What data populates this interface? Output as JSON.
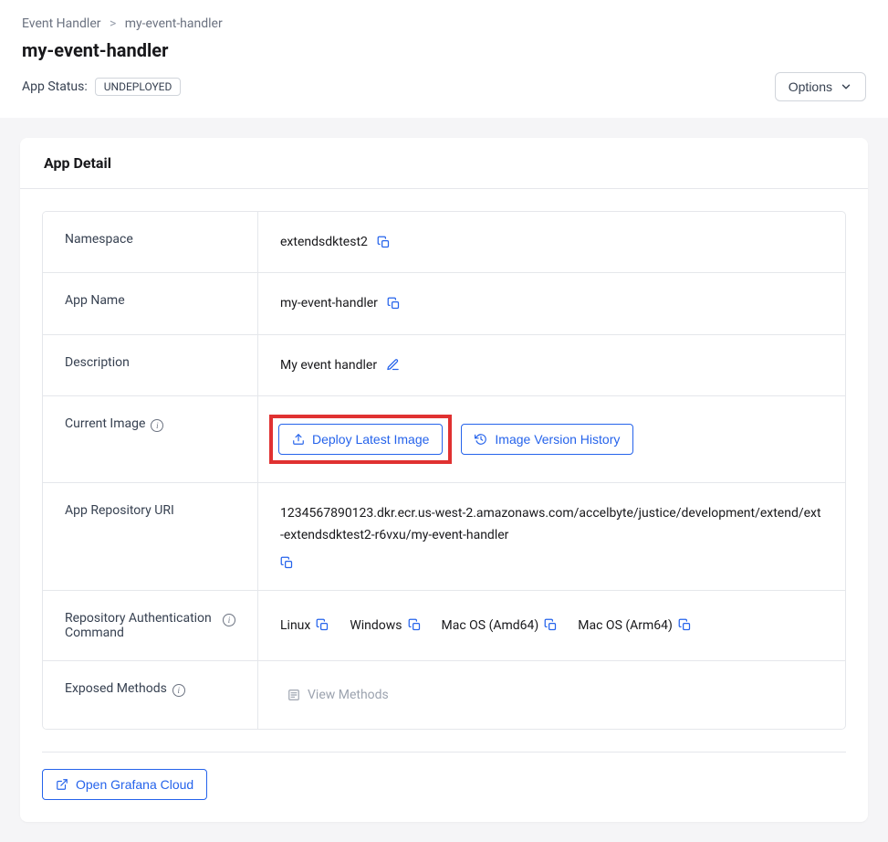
{
  "breadcrumb": {
    "parent": "Event Handler",
    "current": "my-event-handler"
  },
  "page_title": "my-event-handler",
  "app_status": {
    "label": "App Status:",
    "value": "UNDEPLOYED"
  },
  "options_button": "Options",
  "card_title": "App Detail",
  "rows": {
    "namespace": {
      "label": "Namespace",
      "value": "extendsdktest2"
    },
    "app_name": {
      "label": "App Name",
      "value": "my-event-handler"
    },
    "description": {
      "label": "Description",
      "value": "My event handler"
    },
    "current_image": {
      "label": "Current Image",
      "deploy_btn": "Deploy Latest Image",
      "history_btn": "Image Version History"
    },
    "repo_uri": {
      "label": "App Repository URI",
      "value": "1234567890123.dkr.ecr.us-west-2.amazonaws.com/accelbyte/justice/development/extend/ext-extendsdktest2-r6vxu/my-event-handler"
    },
    "repo_auth": {
      "label": "Repository Authentication Command",
      "os": {
        "linux": "Linux",
        "windows": "Windows",
        "mac_amd": "Mac OS (Amd64)",
        "mac_arm": "Mac OS (Arm64)"
      }
    },
    "exposed_methods": {
      "label": "Exposed Methods",
      "view_btn": "View Methods"
    }
  },
  "grafana_btn": "Open Grafana Cloud"
}
